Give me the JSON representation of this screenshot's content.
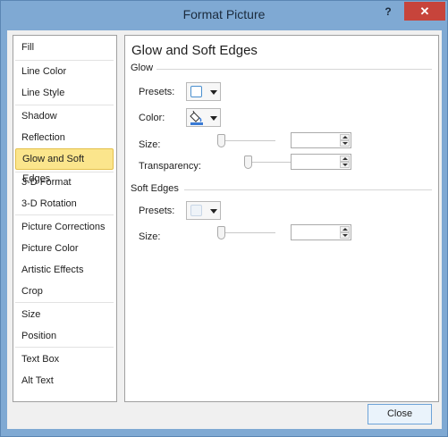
{
  "window": {
    "title": "Format Picture",
    "help_label": "?",
    "close_label": "✕"
  },
  "nav": {
    "items": [
      {
        "label": "Fill"
      },
      {
        "label": "Line Color"
      },
      {
        "label": "Line Style"
      },
      {
        "label": "Shadow"
      },
      {
        "label": "Reflection"
      },
      {
        "label": "Glow and Soft Edges",
        "selected": true
      },
      {
        "label": "3-D Format"
      },
      {
        "label": "3-D Rotation"
      },
      {
        "label": "Picture Corrections"
      },
      {
        "label": "Picture Color"
      },
      {
        "label": "Artistic Effects"
      },
      {
        "label": "Crop"
      },
      {
        "label": "Size"
      },
      {
        "label": "Position"
      },
      {
        "label": "Text Box"
      },
      {
        "label": "Alt Text"
      }
    ]
  },
  "panel": {
    "heading": "Glow and Soft Edges",
    "glow": {
      "section_label": "Glow",
      "presets_label": "Presets:",
      "color_label": "Color:",
      "size_label": "Size:",
      "size_value": "",
      "transparency_label": "Transparency:",
      "transparency_value": ""
    },
    "soft_edges": {
      "section_label": "Soft Edges",
      "presets_label": "Presets:",
      "size_label": "Size:",
      "size_value": ""
    }
  },
  "footer": {
    "close_label": "Close"
  },
  "colors": {
    "title_bar": "#7fa9d3",
    "selected_item": "#fbe58c",
    "window_close": "#c7443b"
  }
}
